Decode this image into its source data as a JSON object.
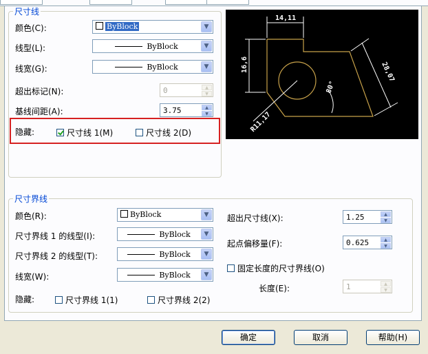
{
  "dimension_lines": {
    "title": "尺寸线",
    "color_label": "颜色(C):",
    "color_value": "ByBlock",
    "linetype_label": "线型(L):",
    "linetype_value": "ByBlock",
    "lineweight_label": "线宽(G):",
    "lineweight_value": "ByBlock",
    "extend_ticks_label": "超出标记(N):",
    "extend_ticks_value": "0",
    "baseline_spacing_label": "基线间距(A):",
    "baseline_spacing_value": "3.75",
    "suppress_label": "隐藏:",
    "suppress_dim1_label": "尺寸线 1(M)",
    "suppress_dim1_checked": true,
    "suppress_dim2_label": "尺寸线 2(D)",
    "suppress_dim2_checked": false
  },
  "preview": {
    "dim_top": "14,11",
    "dim_left": "16,6",
    "dim_right": "28,07",
    "dim_angle": "80°",
    "dim_radius": "R11,17"
  },
  "extension_lines": {
    "title": "尺寸界线",
    "color_label": "颜色(R):",
    "color_value": "ByBlock",
    "linetype1_label": "尺寸界线 1 的线型(I):",
    "linetype1_value": "ByBlock",
    "linetype2_label": "尺寸界线 2 的线型(T):",
    "linetype2_value": "ByBlock",
    "lineweight_label": "线宽(W):",
    "lineweight_value": "ByBlock",
    "suppress_label": "隐藏:",
    "suppress_ext1_label": "尺寸界线 1(1)",
    "suppress_ext2_label": "尺寸界线 2(2)",
    "extend_beyond_label": "超出尺寸线(X):",
    "extend_beyond_value": "1.25",
    "offset_origin_label": "起点偏移量(F):",
    "offset_origin_value": "0.625",
    "fixed_length_label": "固定长度的尺寸界线(O)",
    "length_label": "长度(E):",
    "length_value": "1"
  },
  "buttons": {
    "ok": "确定",
    "cancel": "取消",
    "help": "帮助(H)"
  },
  "colors": {
    "group_title": "#0046d5",
    "highlight_box": "#d62020",
    "preview_bg": "#000000",
    "preview_shape": "#c8a24a",
    "preview_dims": "#ffffff"
  }
}
